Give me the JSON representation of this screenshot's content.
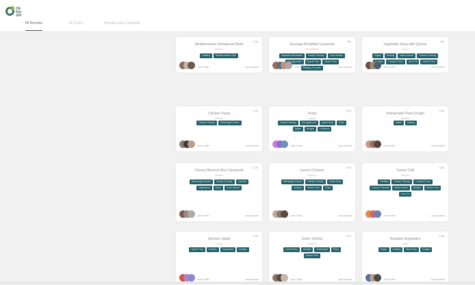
{
  "app": {
    "logo_text": "OE\nNet\nAPI",
    "tabs": [
      {
        "label": "Mi Recetas",
        "active": true
      },
      {
        "label": "Mi Grupo",
        "active": false
      },
      {
        "label": "Recetas para Compartir",
        "active": false
      }
    ]
  },
  "colors": {
    "tag_bg": "#245f68",
    "background": "#f1f1f1",
    "card": "#ffffff"
  },
  "cards": [
    {
      "title": "Mediterranean Restaurant Bowl",
      "subtitle": "Dinner",
      "count": "1.5k",
      "tags": [
        "Healthy",
        "Mediterranean Diet"
      ],
      "avatar_colors": [
        "#8d6b5a",
        "#c9b6a6",
        "#6b5a4f"
      ],
      "author": "Jane Smith",
      "date": "Last updated"
    },
    {
      "title": "Sausage Breakfast Casserole",
      "subtitle": "Breakfast",
      "count": "20k",
      "tags": [
        "Weekend Breakfast",
        "Family Friendly",
        "Cook Ahead",
        "Kid Approved",
        "Quick Prep",
        "Gluten Free",
        "Holiday Favorite"
      ],
      "avatar_colors": [
        "#9a6c5c",
        "#5b6e84",
        "#b39482",
        "#b7a49c"
      ],
      "author": "Jane Smith",
      "date": "Last updated"
    },
    {
      "title": "Vegetable Soup with Quinoa",
      "subtitle": "Lunch",
      "count": "12k",
      "tags": [
        "Vegan",
        "Healthy",
        "Make Ahead",
        "Freezer Friendly",
        "Budget",
        "Comfort Food",
        "One Pot",
        "Gluten Free"
      ],
      "avatar_colors": [
        "#6a4f44",
        "#a4897a",
        "#4e5f70"
      ],
      "author": "Jane Smith",
      "date": "Last updated"
    },
    {
      "title": "Chicken Pasta",
      "subtitle": "Dinner",
      "count": "9.1k",
      "tags": [
        "Family Friendly",
        "Weeknight Dinner"
      ],
      "avatar_colors": [
        "#8d7c6e",
        "#3b3b3b",
        "#b8a090"
      ],
      "author": "Jane Smith",
      "date": "Last updated"
    },
    {
      "title": "Pasta",
      "subtitle": "Dinner",
      "count": "8.1k",
      "tags": [
        "Family Friendly",
        "Kid Approved",
        "Quick Prep",
        "Easy",
        "Italian",
        "Budget",
        "Leftovers"
      ],
      "avatar_colors": [
        "#c27fd8",
        "#8e6bd1",
        "#6f8fb7"
      ],
      "author": "Jane Smith",
      "date": "Last updated"
    },
    {
      "title": "Homemade Pizza Dough",
      "subtitle": "Dinner",
      "count": "9.6k",
      "tags": [
        "Italian",
        "Baking"
      ],
      "avatar_colors": [
        "#c49b8c",
        "#9c7264",
        "#5a4337"
      ],
      "author": "Jane Smith",
      "date": "Last updated"
    },
    {
      "title": "Cheesy Broccoli Rice Casserole",
      "subtitle": "Dinner",
      "count": "3.2k",
      "tags": [
        "Weeknight Dinner",
        "Family Friendly",
        "Comfort",
        "Vegetarian",
        "Easy",
        "Cook Ahead"
      ],
      "avatar_colors": [
        "#7b5b50",
        "#9a8b7e",
        "#b3aaa2"
      ],
      "author": "Jane Smith",
      "date": "Last updated"
    },
    {
      "title": "Lemon Chicken",
      "subtitle": "Dinner",
      "count": "5.0k",
      "tags": [
        "Weeknight Dinner",
        "Family Friendly",
        "Quick Prep",
        "Healthy",
        "Gluten Free",
        "Easy"
      ],
      "avatar_colors": [
        "#c3a89a",
        "#8f7768",
        "#5c4a40"
      ],
      "author": "Jane Smith",
      "date": "Last updated"
    },
    {
      "title": "Turkey Chili",
      "subtitle": "Dinner",
      "count": "4.8k",
      "tags": [
        "Healthy",
        "Family Friendly",
        "Comfort Food",
        "Freezer Friendly",
        "Make Ahead",
        "Budget",
        "Gluten Free",
        "One Pot"
      ],
      "avatar_colors": [
        "#e38b4a",
        "#d66a5c",
        "#6e7eb8"
      ],
      "author": "Jane Smith",
      "date": "Last updated"
    },
    {
      "title": "Spinach Salad",
      "subtitle": "Lunch",
      "count": "3.3k",
      "tags": [
        "Quick Prep",
        "Healthy",
        "Vegetarian",
        "Budget"
      ],
      "avatar_colors": [
        "#d2533d",
        "#b67dd2",
        "#8d8acb"
      ],
      "author": "Jane Smith",
      "date": "Last updated"
    },
    {
      "title": "Garlic Shrimp",
      "subtitle": "Dinner",
      "count": "3.7k",
      "tags": [
        "Quick Prep",
        "Healthy",
        "Weeknight",
        "Easy",
        "Gluten Free"
      ],
      "avatar_colors": [
        "#917363",
        "#5b4c42",
        "#c7b7a9"
      ],
      "author": "Jane Smith",
      "date": "Last updated"
    },
    {
      "title": "Roasted Vegetables",
      "subtitle": "Side",
      "count": "2.5k",
      "tags": [
        "Vegan",
        "Healthy",
        "Meal Prep",
        "Budget"
      ],
      "avatar_colors": [
        "#5270a8",
        "#c49c82",
        "#4a4a4a"
      ],
      "author": "Jane Smith",
      "date": "Last updated"
    }
  ]
}
